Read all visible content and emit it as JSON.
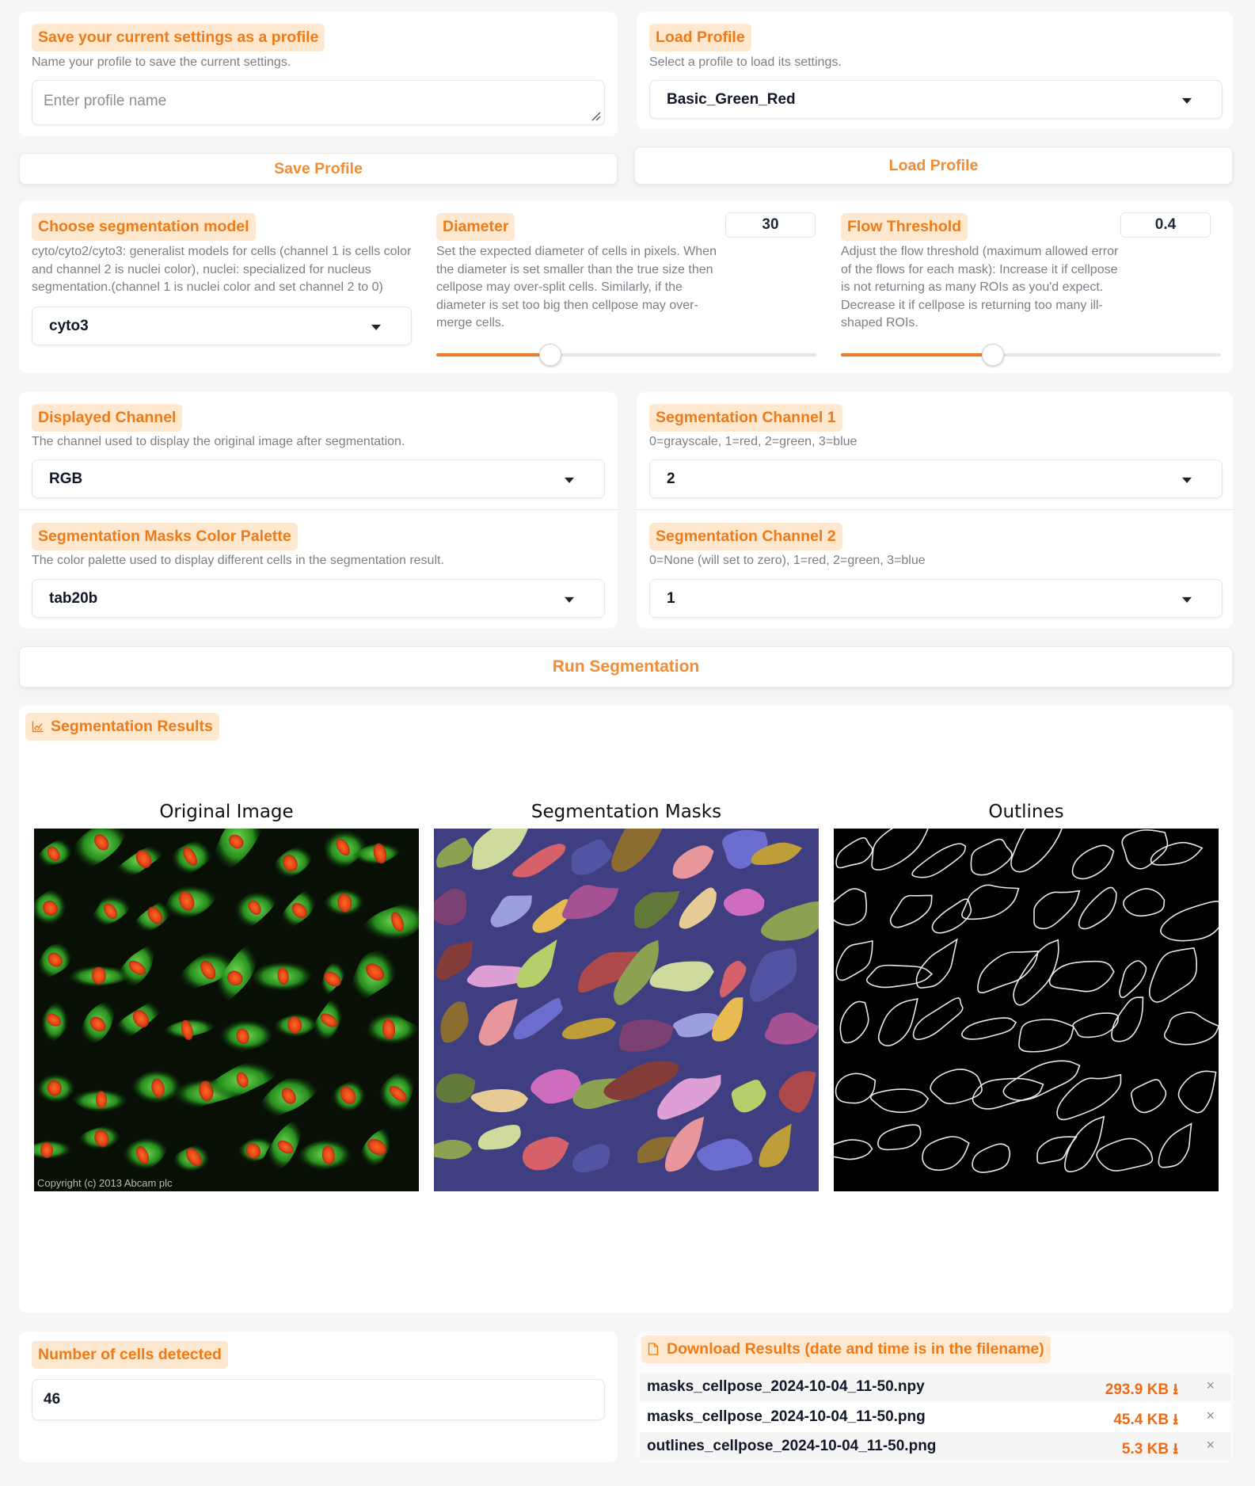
{
  "save_profile": {
    "title": "Save your current settings as a profile",
    "description": "Name your profile to save the current settings.",
    "placeholder": "Enter profile name",
    "button": "Save Profile"
  },
  "load_profile": {
    "title": "Load Profile",
    "description": "Select a profile to load its settings.",
    "selected": "Basic_Green_Red",
    "button": "Load Profile"
  },
  "model": {
    "title": "Choose segmentation model",
    "description": "cyto/cyto2/cyto3: generalist models for cells (channel 1 is cells color and channel 2 is nuclei color), nuclei: specialized for nucleus segmentation.(channel 1 is nuclei color and set channel 2 to 0)",
    "selected": "cyto3"
  },
  "diameter": {
    "title": "Diameter",
    "value": "30",
    "description": "Set the expected diameter of cells in pixels. When the diameter is set smaller than the true size then cellpose may over-split cells. Similarly, if the diameter is set too big then cellpose may over-merge cells.",
    "slider_fraction": 0.3
  },
  "flow": {
    "title": "Flow Threshold",
    "value": "0.4",
    "description": "Adjust the flow threshold (maximum allowed error of the flows for each mask): Increase it if cellpose is not returning as many ROIs as you'd expect. Decrease it if cellpose is returning too many ill-shaped ROIs.",
    "slider_fraction": 0.4
  },
  "displayed_channel": {
    "title": "Displayed Channel",
    "description": "The channel used to display the original image after segmentation.",
    "selected": "RGB"
  },
  "palette": {
    "title": "Segmentation Masks Color Palette",
    "description": "The color palette used to display different cells in the segmentation result.",
    "selected": "tab20b"
  },
  "seg_channel1": {
    "title": "Segmentation Channel 1",
    "description": "0=grayscale, 1=red, 2=green, 3=blue",
    "selected": "2"
  },
  "seg_channel2": {
    "title": "Segmentation Channel 2",
    "description": "0=None (will set to zero), 1=red, 2=green, 3=blue",
    "selected": "1"
  },
  "run_button": "Run Segmentation",
  "results": {
    "title": "Segmentation Results",
    "icon": "chart-icon",
    "plots": [
      "Original Image",
      "Segmentation Masks",
      "Outlines"
    ],
    "copyright": "Copyright (c) 2013 Abcam plc"
  },
  "cells": {
    "title": "Number of cells detected",
    "value": "46"
  },
  "downloads": {
    "title": "Download Results (date and time is in the filename)",
    "icon": "file-icon",
    "files": [
      {
        "name": "masks_cellpose_2024-10-04_11-50.npy",
        "size": "293.9 KB ⭳"
      },
      {
        "name": "masks_cellpose_2024-10-04_11-50.png",
        "size": "45.4 KB ⭳"
      },
      {
        "name": "outlines_cellpose_2024-10-04_11-50.png",
        "size": "5.3 KB ⭳"
      }
    ],
    "remove": "×"
  },
  "colors": {
    "accent": "#f07a16",
    "tag_bg": "#ffe8d0",
    "page_bg": "#f6f6f7"
  }
}
